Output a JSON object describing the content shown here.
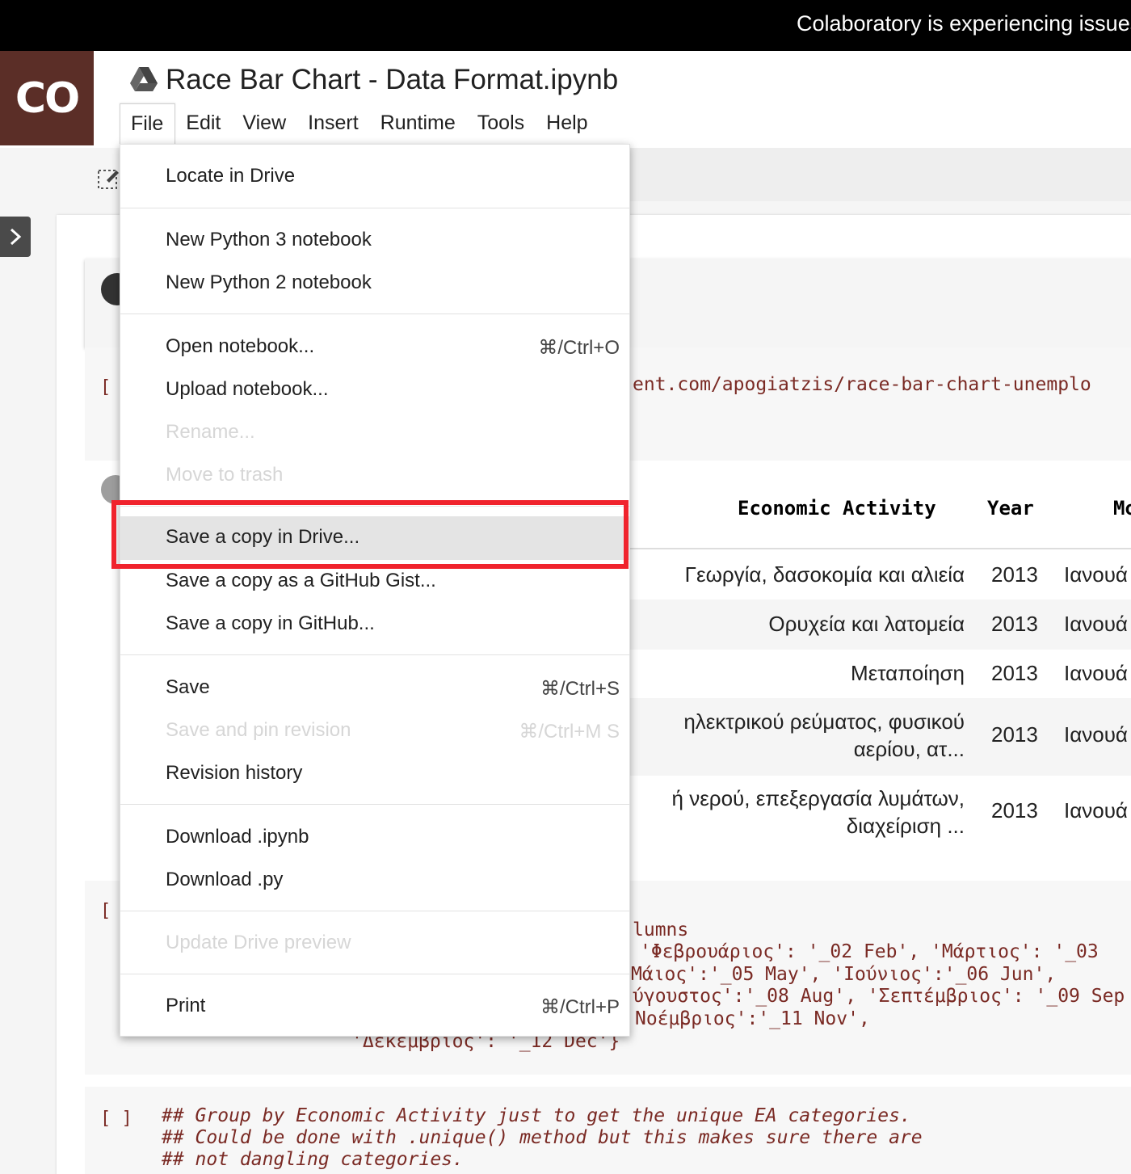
{
  "banner": {
    "text": "Colaboratory is experiencing issues"
  },
  "app": {
    "logo_text": "CO",
    "title": "Race Bar Chart - Data Format.ipynb"
  },
  "menubar": [
    "File",
    "Edit",
    "View",
    "Insert",
    "Runtime",
    "Tools",
    "Help"
  ],
  "file_menu": {
    "locate": "Locate in Drive",
    "new_py3": "New Python 3 notebook",
    "new_py2": "New Python 2 notebook",
    "open": "Open notebook...",
    "open_shortcut": "⌘/Ctrl+O",
    "upload": "Upload notebook...",
    "rename": "Rename...",
    "trash": "Move to trash",
    "save_copy_drive": "Save a copy in Drive...",
    "save_copy_gist": "Save a copy as a GitHub Gist...",
    "save_copy_github": "Save a copy in GitHub...",
    "save": "Save",
    "save_shortcut": "⌘/Ctrl+S",
    "save_pin": "Save and pin revision",
    "save_pin_shortcut": "⌘/Ctrl+M S",
    "revision": "Revision history",
    "download_ipynb": "Download .ipynb",
    "download_py": "Download .py",
    "update_preview": "Update Drive preview",
    "print": "Print",
    "print_shortcut": "⌘/Ctrl+P"
  },
  "cells": {
    "cell2_bracket": "[",
    "cell2_code": "ent.com/apogiatzis/race-bar-chart-unemplo",
    "cell4_bracket": "[",
    "cell4_lines": [
      "lumns",
      "'Φεβρουάριος': '_02 Feb', 'Μάρτιος': '_03",
      "Μάιος':'_05 May', 'Ιούνιος':'_06 Jun',",
      "ύγουστος':'_08 Aug', 'Σεπτέμβριος': '_09 Sep",
      "Νοέμβριος':'_11 Nov',"
    ],
    "cell4_last": "'Δεκέμβριος': '_12 Dec'}",
    "cell5_bracket": "[ ]",
    "cell5_lines": [
      "## Group by Economic Activity just to get the unique EA categories.",
      "## Could be done with .unique() method but this makes sure there are",
      "## not dangling categories."
    ]
  },
  "table": {
    "headers": [
      "Economic Activity",
      "Year",
      "Mo"
    ],
    "rows": [
      {
        "activity": "Γεωργία, δασοκομία και αλιεία",
        "year": "2013",
        "month": "Ιανουά"
      },
      {
        "activity": "Ορυχεία και λατομεία",
        "year": "2013",
        "month": "Ιανουά"
      },
      {
        "activity": "Μεταποίηση",
        "year": "2013",
        "month": "Ιανουά"
      },
      {
        "activity": "ηλεκτρικού ρεύματος, φυσικού",
        "activity2": "αερίου, ατ...",
        "year": "2013",
        "month": "Ιανουά"
      },
      {
        "activity": "ή νερού, επεξεργασία λυμάτων,",
        "activity2": "διαχείριση ...",
        "year": "2013",
        "month": "Ιανουά"
      }
    ]
  },
  "colors": {
    "logo_bg": "#5b2e27",
    "highlight_box": "#f0232d",
    "code_text": "#7a2a24"
  },
  "icons": [
    "drive-icon",
    "edit-icon",
    "chevron-right-icon",
    "play-icon",
    "output-icon"
  ]
}
